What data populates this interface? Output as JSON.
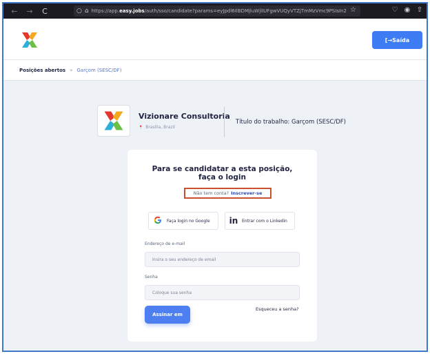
{
  "browser": {
    "url_prefix": "https://app.",
    "url_host": "easy.jobs",
    "url_rest": "/auth/sso/candidate?params=eyJpdl6IlBDMjluWjlIUFgwVUQyVTZjTmMzVmc9PSIsIn2",
    "back_icon": "←",
    "forward_icon": "→",
    "reload_icon": "C",
    "shield_icon": "○",
    "lock_icon": "⌂",
    "star_icon": "☆",
    "pocket_icon": "♡",
    "account_icon": "◉",
    "extensions_icon": "⇧"
  },
  "header": {
    "exit_label": "[→Saída"
  },
  "breadcrumb": {
    "home": "Posições abertos",
    "separator": "»",
    "current": "Garçom (SESC/DF)"
  },
  "company": {
    "name": "Vizionare Consultoria",
    "location_icon": "📍",
    "location": "Brasília, Brazil",
    "job_title": "Título do trabalho: Garçom (SESC/DF)"
  },
  "login": {
    "title": "Para se candidatar a esta posição, faça o login",
    "no_account": "Não tem conta?",
    "signup_link": "Inscrever-se",
    "google_label": "Faça login no Google",
    "linkedin_label": "Entrar com o Linkedin",
    "email_label": "Endereço de e-mail",
    "email_placeholder": "Insira o seu endereço de email",
    "password_label": "Senha",
    "password_placeholder": "Coloque sua senha",
    "submit_label": "Assinar em",
    "forgot_label": "Esqueceu a senha?"
  },
  "colors": {
    "accent": "#3d7cf2",
    "frame": "#3f78c8",
    "highlight": "#c8512b"
  }
}
